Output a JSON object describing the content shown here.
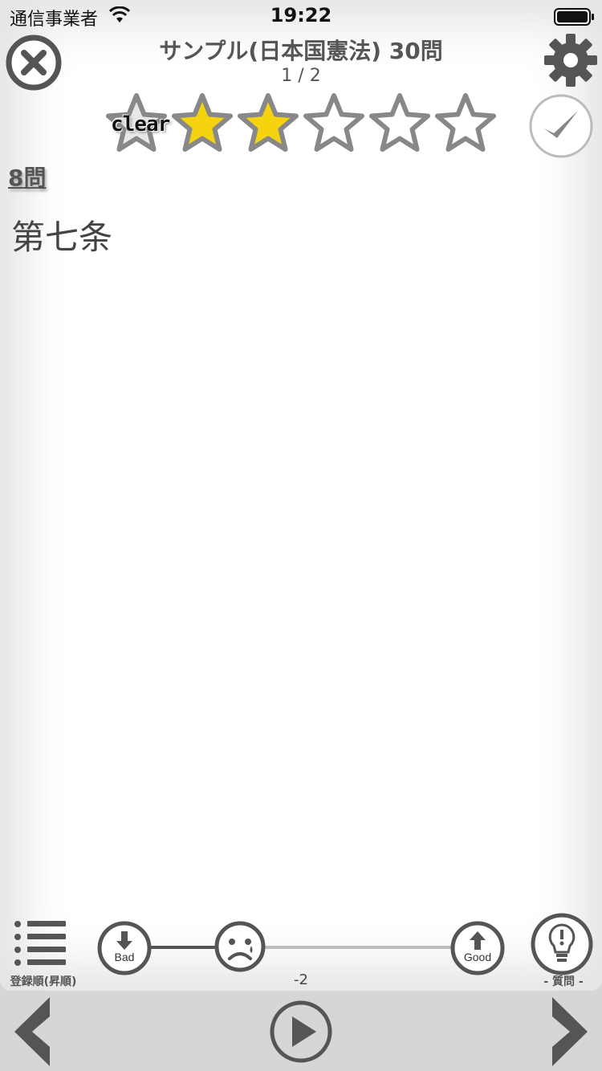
{
  "status_bar": {
    "carrier": "通信事業者",
    "time": "19:22"
  },
  "header": {
    "title": "サンプル(日本国憲法) 30問",
    "page_indicator": "1 / 2",
    "close_icon": "close-icon",
    "settings_icon": "gear-icon"
  },
  "rating": {
    "clear_label": "clear",
    "level": 2,
    "max": 5,
    "filled_color": "#f5d40f",
    "empty_color": "#ffffff"
  },
  "question": {
    "count_label": "8問",
    "text": "第七条"
  },
  "controls": {
    "list_label": "登録順(昇順)",
    "bad_label": "Bad",
    "good_label": "Good",
    "score": "-2",
    "hint_label": "- 質問 -"
  },
  "navigation": {
    "prev_icon": "chevron-left-icon",
    "play_icon": "play-icon",
    "next_icon": "chevron-right-icon"
  }
}
